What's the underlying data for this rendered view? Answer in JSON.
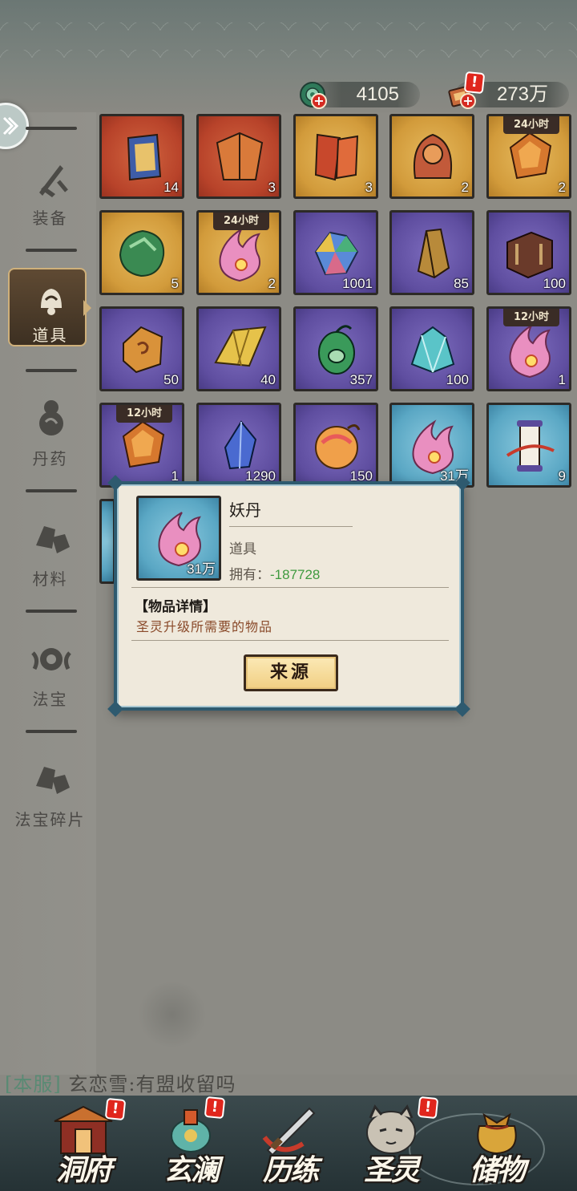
{
  "currency": {
    "jade": {
      "value": "4105",
      "icon": "jade-coin-icon"
    },
    "tokens": {
      "value": "273万",
      "icon": "ticket-icon"
    }
  },
  "sidebar": {
    "items": [
      {
        "label": "装备",
        "icon": "sword-icon",
        "active": false
      },
      {
        "label": "道具",
        "icon": "bell-icon",
        "active": true
      },
      {
        "label": "丹药",
        "icon": "gourd-icon",
        "active": false
      },
      {
        "label": "材料",
        "icon": "ore-icon",
        "active": false
      },
      {
        "label": "法宝",
        "icon": "talisman-icon",
        "active": false
      },
      {
        "label": "法宝碎片",
        "icon": "fragment-icon",
        "active": false
      }
    ]
  },
  "inventory": {
    "items": [
      {
        "rarity": "red",
        "count": "14",
        "timer": "",
        "icon": "armor-piece-icon"
      },
      {
        "rarity": "red",
        "count": "3",
        "timer": "",
        "icon": "robe-icon"
      },
      {
        "rarity": "gold",
        "count": "3",
        "timer": "",
        "icon": "scroll-bundle-icon"
      },
      {
        "rarity": "gold",
        "count": "2",
        "timer": "",
        "icon": "relic-icon"
      },
      {
        "rarity": "gold",
        "count": "2",
        "timer": "24小时",
        "icon": "amber-gem-icon"
      },
      {
        "rarity": "gold",
        "count": "5",
        "timer": "",
        "icon": "jade-ore-icon"
      },
      {
        "rarity": "gold",
        "count": "2",
        "timer": "24小时",
        "icon": "flame-orb-icon"
      },
      {
        "rarity": "purple",
        "count": "1001",
        "timer": "",
        "icon": "rainbow-crystal-icon"
      },
      {
        "rarity": "purple",
        "count": "85",
        "timer": "",
        "icon": "crystal-pillar-icon"
      },
      {
        "rarity": "purple",
        "count": "100",
        "timer": "",
        "icon": "wood-block-icon"
      },
      {
        "rarity": "purple",
        "count": "50",
        "timer": "",
        "icon": "spiral-stone-icon"
      },
      {
        "rarity": "purple",
        "count": "40",
        "timer": "",
        "icon": "gold-crystal-icon"
      },
      {
        "rarity": "purple",
        "count": "357",
        "timer": "",
        "icon": "jade-pendant-icon"
      },
      {
        "rarity": "purple",
        "count": "100",
        "timer": "",
        "icon": "ice-crystal-icon"
      },
      {
        "rarity": "purple",
        "count": "1",
        "timer": "12小时",
        "icon": "flame-orb-icon"
      },
      {
        "rarity": "purple",
        "count": "1",
        "timer": "12小时",
        "icon": "amber-gem-icon"
      },
      {
        "rarity": "purple",
        "count": "1290",
        "timer": "",
        "icon": "blue-gem-icon"
      },
      {
        "rarity": "purple",
        "count": "150",
        "timer": "",
        "icon": "peach-orb-icon"
      },
      {
        "rarity": "blue",
        "count": "31万",
        "timer": "",
        "icon": "flame-orb-icon"
      },
      {
        "rarity": "blue",
        "count": "9",
        "timer": "",
        "icon": "scroll-icon"
      }
    ]
  },
  "popup": {
    "name": "妖丹",
    "type": "道具",
    "own_label": "拥有：",
    "own_value": "-187728",
    "count": "31万",
    "detail_title": "【物品详情】",
    "detail_text": "圣灵升级所需要的物品",
    "source_button": "来源"
  },
  "chat": {
    "channel": "[本服]",
    "message": "玄恋雪:有盟收留吗"
  },
  "bottom_nav": [
    {
      "label": "洞府",
      "icon": "temple-icon",
      "alert": "!"
    },
    {
      "label": "玄澜",
      "icon": "lantern-icon",
      "alert": "!"
    },
    {
      "label": "历练",
      "icon": "sword-icon",
      "alert": ""
    },
    {
      "label": "圣灵",
      "icon": "tiger-icon",
      "alert": "!"
    },
    {
      "label": "储物",
      "icon": "pouch-icon",
      "alert": ""
    }
  ],
  "colors": {
    "popup_border": "#2e5a6f",
    "own_value": "#3f9a3f",
    "detail_text": "#8a4a2a",
    "alert": "#e0261d"
  }
}
